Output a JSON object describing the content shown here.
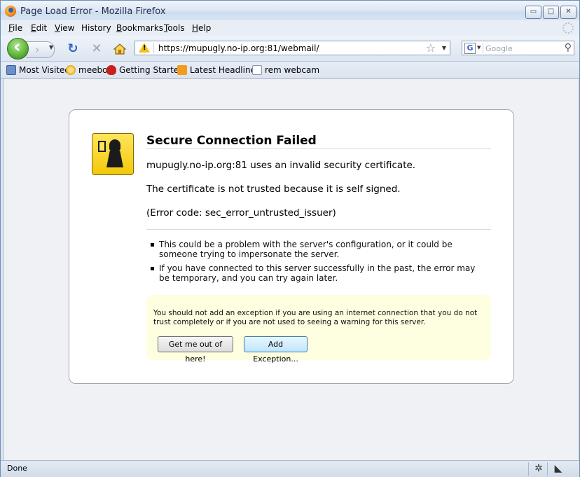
{
  "window": {
    "title": "Page Load Error - Mozilla Firefox",
    "controls": {
      "minimize": "▭",
      "maximize": "□",
      "close": "✕"
    }
  },
  "menu": {
    "items": [
      {
        "label": "File",
        "key": "F",
        "rest": "ile"
      },
      {
        "label": "Edit",
        "key": "E",
        "rest": "dit"
      },
      {
        "label": "View",
        "key": "V",
        "rest": "iew"
      },
      {
        "label": "History",
        "key": "",
        "rest": "History"
      },
      {
        "label": "Bookmarks",
        "key": "B",
        "rest": "ookmarks"
      },
      {
        "label": "Tools",
        "key": "T",
        "rest": "ools"
      },
      {
        "label": "Help",
        "key": "H",
        "rest": "elp"
      }
    ]
  },
  "navigation": {
    "url": "https://mupugly.no-ip.org:81/webmail/",
    "search_placeholder": "Google",
    "search_engine_letter": "G",
    "icons": {
      "back": "back-arrow-icon",
      "forward": "forward-arrow-icon",
      "reload": "reload-icon",
      "stop": "stop-icon",
      "home": "home-icon",
      "security_warning": "warning-icon",
      "bookmark_star": "star-icon",
      "search": "magnifier-icon"
    }
  },
  "bookmarks": [
    {
      "label": "Most Visited",
      "icon": "most-visited-icon"
    },
    {
      "label": "meebo",
      "icon": "meebo-icon"
    },
    {
      "label": "Getting Started",
      "icon": "getting-started-icon"
    },
    {
      "label": "Latest Headlines",
      "icon": "rss-icon"
    },
    {
      "label": "rem webcam",
      "icon": "page-icon"
    }
  ],
  "error": {
    "title": "Secure Connection Failed",
    "line1": "mupugly.no-ip.org:81 uses an invalid security certificate.",
    "line2": "The certificate is not trusted because it is self signed.",
    "line3": "(Error code: sec_error_untrusted_issuer)",
    "bullets": [
      "This could be a problem with the server's configuration, or it could be someone trying to impersonate the server.",
      "If you have connected to this server successfully in the past, the error may be temporary, and you can try again later."
    ],
    "advice": "You should not add an exception if you are using an internet connection that you do not trust completely or if you are not used to seeing a warning for this server.",
    "buttons": {
      "get_out": "Get me out of here!",
      "add_exception": "Add Exception..."
    },
    "colors": {
      "advice_bg": "#fefee0",
      "icon_yellow": "#f3c80a"
    }
  },
  "status": {
    "text": "Done",
    "icons": [
      "bug-icon",
      "network-icon"
    ]
  }
}
